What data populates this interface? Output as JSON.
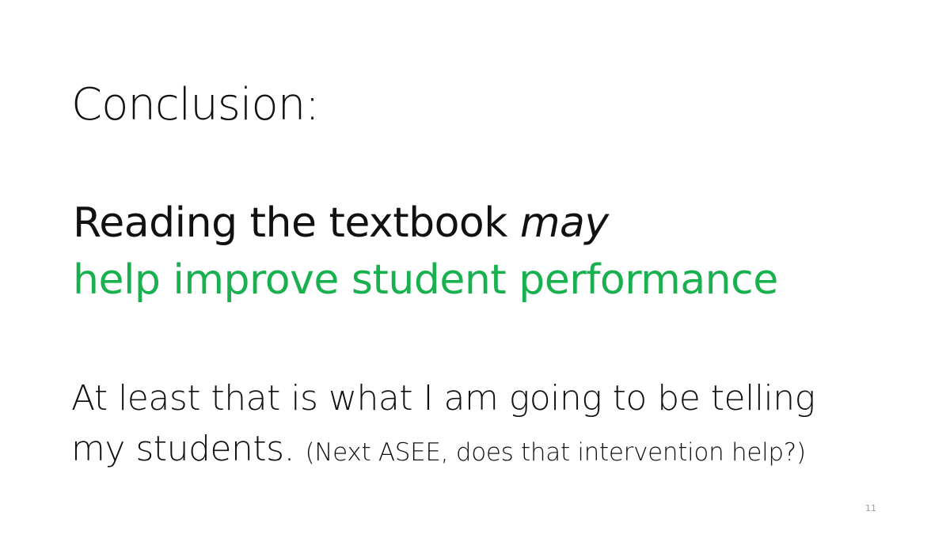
{
  "slide": {
    "title": "Conclusion:",
    "claim": {
      "lead": "Reading the textbook",
      "hedge": "may",
      "highlight": "help improve student performance"
    },
    "body": {
      "line1": "At least that is what I am going to be telling",
      "line2": "my students.",
      "aside": "(Next ASEE, does that intervention help?)"
    },
    "slide_number": "11"
  },
  "colors": {
    "background": "#ffffff",
    "text": "#111111",
    "accent_green": "#19b14f",
    "slide_number": "#9a9a9a"
  }
}
